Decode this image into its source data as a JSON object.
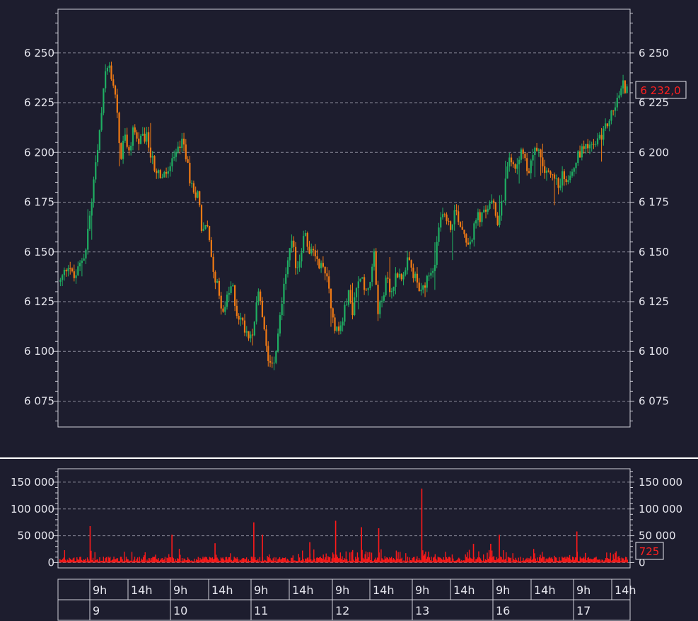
{
  "colors": {
    "background": "#1d1d2e",
    "frame": "#cfcfd8",
    "grid": "#8a8a99",
    "text": "#e6e6ee",
    "up": "#1fae62",
    "down": "#f07a14",
    "volume": "#ff1a1a",
    "last_price": "#ff2020",
    "separator": "#ffffff"
  },
  "chart_data": [
    {
      "type": "candlestick",
      "name": "price",
      "ylim": [
        6062,
        6272
      ],
      "y_ticks": [
        6075,
        6100,
        6125,
        6150,
        6175,
        6200,
        6225,
        6250
      ],
      "y_tick_labels": [
        "6 075",
        "6 100",
        "6 125",
        "6 150",
        "6 175",
        "6 200",
        "6 225",
        "6 250"
      ],
      "grid": true,
      "last_value_label": "6 232,0",
      "path": [
        [
          0,
          6135
        ],
        [
          2,
          6145
        ],
        [
          3,
          6136
        ],
        [
          4,
          6140
        ],
        [
          6,
          6152
        ],
        [
          8,
          6190
        ],
        [
          9,
          6205
        ],
        [
          10,
          6232
        ],
        [
          11,
          6246
        ],
        [
          12,
          6238
        ],
        [
          13,
          6228
        ],
        [
          14,
          6195
        ],
        [
          15,
          6210
        ],
        [
          16,
          6198
        ],
        [
          17,
          6213
        ],
        [
          18,
          6205
        ],
        [
          20,
          6208
        ],
        [
          22,
          6192
        ],
        [
          24,
          6187
        ],
        [
          26,
          6194
        ],
        [
          28,
          6205
        ],
        [
          29,
          6202
        ],
        [
          30,
          6188
        ],
        [
          31,
          6178
        ],
        [
          32,
          6182
        ],
        [
          33,
          6160
        ],
        [
          34,
          6165
        ],
        [
          35,
          6150
        ],
        [
          36,
          6138
        ],
        [
          37,
          6128
        ],
        [
          38,
          6120
        ],
        [
          40,
          6134
        ],
        [
          41,
          6120
        ],
        [
          43,
          6112
        ],
        [
          44,
          6108
        ],
        [
          45,
          6112
        ],
        [
          46,
          6130
        ],
        [
          47,
          6118
        ],
        [
          48,
          6100
        ],
        [
          49,
          6094
        ],
        [
          50,
          6098
        ],
        [
          51,
          6115
        ],
        [
          52,
          6132
        ],
        [
          53,
          6145
        ],
        [
          54,
          6155
        ],
        [
          55,
          6140
        ],
        [
          56,
          6150
        ],
        [
          57,
          6160
        ],
        [
          58,
          6148
        ],
        [
          59,
          6152
        ],
        [
          60,
          6145
        ],
        [
          62,
          6140
        ],
        [
          63,
          6125
        ],
        [
          64,
          6112
        ],
        [
          65,
          6110
        ],
        [
          66,
          6118
        ],
        [
          67,
          6130
        ],
        [
          68,
          6120
        ],
        [
          70,
          6140
        ],
        [
          71,
          6128
        ],
        [
          72,
          6135
        ],
        [
          73,
          6150
        ],
        [
          74,
          6120
        ],
        [
          76,
          6136
        ],
        [
          77,
          6128
        ],
        [
          78,
          6138
        ],
        [
          79,
          6140
        ],
        [
          80,
          6136
        ],
        [
          81,
          6146
        ],
        [
          82,
          6140
        ],
        [
          83,
          6135
        ],
        [
          84,
          6128
        ],
        [
          86,
          6138
        ],
        [
          87,
          6140
        ],
        [
          88,
          6158
        ],
        [
          89,
          6172
        ],
        [
          90,
          6165
        ],
        [
          91,
          6162
        ],
        [
          92,
          6172
        ],
        [
          93,
          6165
        ],
        [
          94,
          6160
        ],
        [
          95,
          6155
        ],
        [
          96,
          6158
        ],
        [
          97,
          6168
        ],
        [
          98,
          6167
        ],
        [
          99,
          6170
        ],
        [
          100,
          6175
        ],
        [
          101,
          6172
        ],
        [
          102,
          6165
        ],
        [
          103,
          6175
        ],
        [
          104,
          6190
        ],
        [
          105,
          6198
        ],
        [
          106,
          6194
        ],
        [
          107,
          6200
        ],
        [
          108,
          6196
        ],
        [
          109,
          6190
        ],
        [
          110,
          6198
        ],
        [
          111,
          6203
        ],
        [
          112,
          6195
        ],
        [
          113,
          6192
        ],
        [
          114,
          6190
        ],
        [
          115,
          6185
        ],
        [
          116,
          6184
        ],
        [
          117,
          6188
        ],
        [
          118,
          6187
        ],
        [
          119,
          6192
        ],
        [
          120,
          6195
        ],
        [
          121,
          6200
        ],
        [
          122,
          6204
        ],
        [
          123,
          6205
        ],
        [
          124,
          6202
        ],
        [
          125,
          6205
        ],
        [
          126,
          6208
        ],
        [
          127,
          6212
        ],
        [
          128,
          6218
        ],
        [
          129,
          6222
        ],
        [
          130,
          6228
        ],
        [
          131,
          6234
        ],
        [
          132,
          6232
        ]
      ]
    },
    {
      "type": "bar",
      "name": "volume",
      "ylim": [
        -10000,
        175000
      ],
      "y_ticks": [
        0,
        50000,
        100000,
        150000
      ],
      "y_tick_labels": [
        "0",
        "50 000",
        "100 000",
        "150 000"
      ],
      "grid": true,
      "last_value_label": "725",
      "spikes": [
        [
          7,
          68000
        ],
        [
          26,
          52000
        ],
        [
          36,
          36000
        ],
        [
          45,
          75000
        ],
        [
          47,
          52000
        ],
        [
          58,
          38000
        ],
        [
          64,
          78000
        ],
        [
          70,
          66000
        ],
        [
          74,
          64000
        ],
        [
          84,
          138000
        ],
        [
          96,
          35000
        ],
        [
          100,
          35000
        ],
        [
          102,
          52000
        ],
        [
          120,
          58000
        ],
        [
          122,
          18000
        ]
      ]
    }
  ],
  "time_axis": {
    "hours": [
      "9h",
      "14h",
      "9h",
      "14h",
      "9h",
      "14h",
      "9h",
      "14h",
      "9h",
      "14h",
      "9h",
      "14h",
      "9h",
      "14h"
    ],
    "days": [
      "9",
      "10",
      "11",
      "12",
      "13",
      "16",
      "17"
    ]
  }
}
